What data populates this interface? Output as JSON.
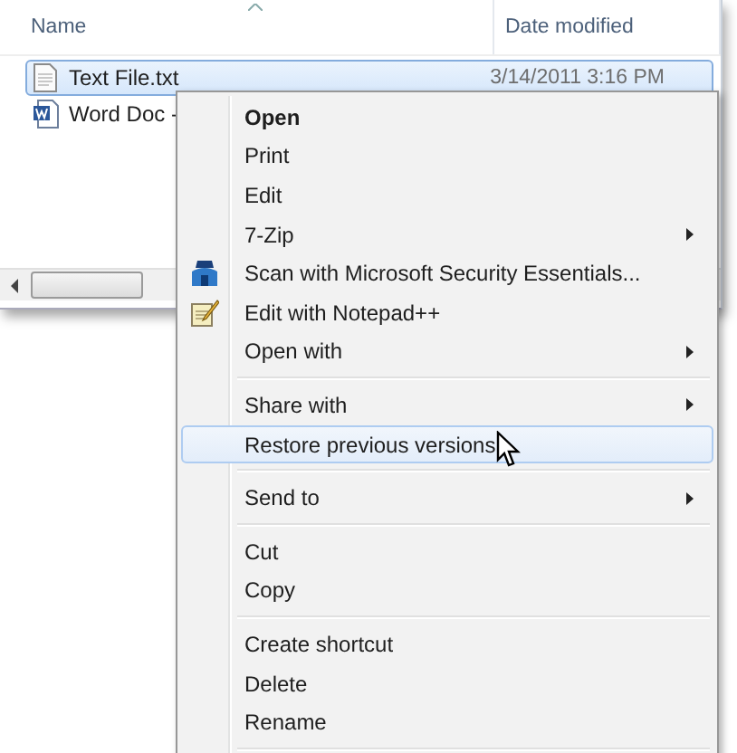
{
  "file_list": {
    "columns": [
      "Name",
      "Date modified"
    ],
    "files": [
      {
        "name": "Text File.txt",
        "date": "3/14/2011 3:16 PM",
        "selected": true
      },
      {
        "name": "Word Doc -",
        "selected": false
      }
    ]
  },
  "context_menu": {
    "items": [
      {
        "kind": "item",
        "label": "Open",
        "bold": true,
        "submenu": false,
        "selected": false
      },
      {
        "kind": "item",
        "label": "Print",
        "bold": false,
        "submenu": false,
        "selected": false
      },
      {
        "kind": "item",
        "label": "Edit",
        "bold": false,
        "submenu": false,
        "selected": false
      },
      {
        "kind": "item",
        "label": "7-Zip",
        "bold": false,
        "submenu": true,
        "selected": false
      },
      {
        "kind": "icon_item",
        "label": "Scan with Microsoft Security Essentials...",
        "bold": false,
        "submenu": false,
        "selected": false
      },
      {
        "kind": "icon_item",
        "label": "Edit with Notepad++",
        "bold": false,
        "submenu": false,
        "selected": false
      },
      {
        "kind": "item",
        "label": "Open with",
        "bold": false,
        "submenu": true,
        "selected": false
      },
      {
        "kind": "separator"
      },
      {
        "kind": "item",
        "label": "Share with",
        "bold": false,
        "submenu": true,
        "selected": false
      },
      {
        "kind": "item",
        "label": "Restore previous versions",
        "bold": false,
        "submenu": false,
        "selected": true
      },
      {
        "kind": "separator"
      },
      {
        "kind": "item",
        "label": "Send to",
        "bold": false,
        "submenu": true,
        "selected": false
      },
      {
        "kind": "separator"
      },
      {
        "kind": "item",
        "label": "Cut",
        "bold": false,
        "submenu": false,
        "selected": false
      },
      {
        "kind": "item",
        "label": "Copy",
        "bold": false,
        "submenu": false,
        "selected": false
      },
      {
        "kind": "separator"
      },
      {
        "kind": "item",
        "label": "Create shortcut",
        "bold": false,
        "submenu": false,
        "selected": false
      },
      {
        "kind": "item",
        "label": "Delete",
        "bold": false,
        "submenu": false,
        "selected": false
      },
      {
        "kind": "item",
        "label": "Rename",
        "bold": false,
        "submenu": false,
        "selected": false
      },
      {
        "kind": "separator"
      }
    ]
  }
}
